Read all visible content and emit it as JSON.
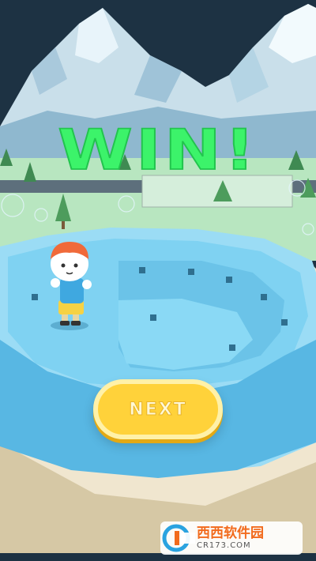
{
  "result": {
    "title": "WIN!"
  },
  "buttons": {
    "next_label": "NEXT"
  },
  "watermark": {
    "name": "西西软件园",
    "url": "CR173.COM"
  },
  "colors": {
    "win_text": "#3cf36a",
    "next_button": "#ffd23a",
    "pool_water": "#7fd2f2",
    "pool_rim": "#4bb6e6",
    "sky": "#1d3243"
  }
}
